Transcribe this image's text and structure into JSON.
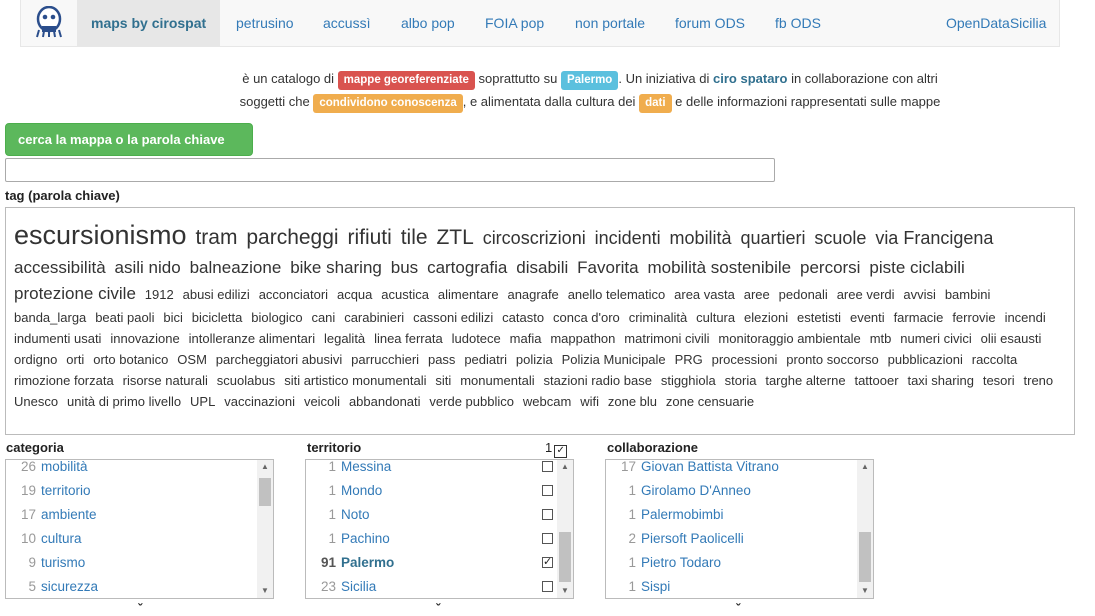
{
  "nav": {
    "brand": "maps by cirospat",
    "links": [
      "petrusino",
      "accussì",
      "albo pop",
      "FOIA pop",
      "non portale",
      "forum ODS",
      "fb ODS"
    ],
    "right": "OpenDataSicilia"
  },
  "intro": {
    "p1": "è un catalogo di",
    "b1": "mappe georeferenziate",
    "p2": "soprattutto su",
    "b2": "Palermo",
    "p3": ". Un iniziativa di",
    "author": "ciro spataro",
    "p4": "in collaborazione con altri",
    "p5": "soggetti che",
    "b3": "condividono conoscenza",
    "p6": ", e alimentata dalla cultura dei",
    "b4": "dati",
    "p7": "e delle informazioni rappresentati sulle mappe"
  },
  "search": {
    "button": "cerca la mappa o la parola chiave",
    "value": ""
  },
  "tags_label": "tag (parola chiave)",
  "tags": [
    {
      "t": "escursionismo",
      "s": 1
    },
    {
      "t": "tram",
      "s": 2
    },
    {
      "t": "parcheggi",
      "s": 2
    },
    {
      "t": "rifiuti",
      "s": 2
    },
    {
      "t": "tile",
      "s": 2
    },
    {
      "t": "ZTL",
      "s": 2
    },
    {
      "t": "circoscrizioni",
      "s": 3
    },
    {
      "t": "incidenti",
      "s": 3
    },
    {
      "t": "mobilità",
      "s": 3
    },
    {
      "t": "quartieri",
      "s": 3
    },
    {
      "t": "scuole",
      "s": 3
    },
    {
      "t": "via Francigena",
      "s": 3
    },
    {
      "t": "accessibilità",
      "s": 4
    },
    {
      "t": "asili nido",
      "s": 4
    },
    {
      "t": "balneazione",
      "s": 4
    },
    {
      "t": "bike sharing",
      "s": 4
    },
    {
      "t": "bus",
      "s": 4
    },
    {
      "t": "cartografia",
      "s": 4
    },
    {
      "t": "disabili",
      "s": 4
    },
    {
      "t": "Favorita",
      "s": 4
    },
    {
      "t": "mobilità sostenibile",
      "s": 4
    },
    {
      "t": "percorsi",
      "s": 4
    },
    {
      "t": "piste ciclabili",
      "s": 4
    },
    {
      "t": "protezione civile",
      "s": 4
    },
    {
      "t": "1912",
      "s": 5
    },
    {
      "t": "abusi edilizi",
      "s": 5
    },
    {
      "t": "acconciatori",
      "s": 5
    },
    {
      "t": "acqua",
      "s": 5
    },
    {
      "t": "acustica",
      "s": 5
    },
    {
      "t": "alimentare",
      "s": 5
    },
    {
      "t": "anagrafe",
      "s": 5
    },
    {
      "t": "anello telematico",
      "s": 5
    },
    {
      "t": "area vasta",
      "s": 5
    },
    {
      "t": "aree",
      "s": 5
    },
    {
      "t": "pedonali",
      "s": 5
    },
    {
      "t": "aree verdi",
      "s": 5
    },
    {
      "t": "avvisi",
      "s": 5
    },
    {
      "t": "bambini",
      "s": 5
    },
    {
      "t": "banda_larga",
      "s": 5
    },
    {
      "t": "beati paoli",
      "s": 5
    },
    {
      "t": "bici",
      "s": 5
    },
    {
      "t": "bicicletta",
      "s": 5
    },
    {
      "t": "biologico",
      "s": 5
    },
    {
      "t": "cani",
      "s": 5
    },
    {
      "t": "carabinieri",
      "s": 5
    },
    {
      "t": "cassoni edilizi",
      "s": 5
    },
    {
      "t": "catasto",
      "s": 5
    },
    {
      "t": "conca d'oro",
      "s": 5
    },
    {
      "t": "criminalità",
      "s": 5
    },
    {
      "t": "cultura",
      "s": 5
    },
    {
      "t": "elezioni",
      "s": 5
    },
    {
      "t": "estetisti",
      "s": 5
    },
    {
      "t": "eventi",
      "s": 5
    },
    {
      "t": "farmacie",
      "s": 5
    },
    {
      "t": "ferrovie",
      "s": 5
    },
    {
      "t": "incendi",
      "s": 5
    },
    {
      "t": "indumenti usati",
      "s": 5
    },
    {
      "t": "innovazione",
      "s": 5
    },
    {
      "t": "intolleranze alimentari",
      "s": 5
    },
    {
      "t": "legalità",
      "s": 5
    },
    {
      "t": "linea ferrata",
      "s": 5
    },
    {
      "t": "ludotece",
      "s": 5
    },
    {
      "t": "mafia",
      "s": 5
    },
    {
      "t": "mappathon",
      "s": 5
    },
    {
      "t": "matrimoni civili",
      "s": 5
    },
    {
      "t": "monitoraggio ambientale",
      "s": 5
    },
    {
      "t": "mtb",
      "s": 5
    },
    {
      "t": "numeri civici",
      "s": 5
    },
    {
      "t": "olii esausti",
      "s": 5
    },
    {
      "t": "ordigno",
      "s": 5
    },
    {
      "t": "orti",
      "s": 5
    },
    {
      "t": "orto botanico",
      "s": 5
    },
    {
      "t": "OSM",
      "s": 5
    },
    {
      "t": "parcheggiatori abusivi",
      "s": 5
    },
    {
      "t": "parrucchieri",
      "s": 5
    },
    {
      "t": "pass",
      "s": 5
    },
    {
      "t": "pediatri",
      "s": 5
    },
    {
      "t": "polizia",
      "s": 5
    },
    {
      "t": "Polizia Municipale",
      "s": 5
    },
    {
      "t": "PRG",
      "s": 5
    },
    {
      "t": "processioni",
      "s": 5
    },
    {
      "t": "pronto soccorso",
      "s": 5
    },
    {
      "t": "pubblicazioni",
      "s": 5
    },
    {
      "t": "raccolta",
      "s": 5
    },
    {
      "t": "rimozione forzata",
      "s": 5
    },
    {
      "t": "risorse naturali",
      "s": 5
    },
    {
      "t": "scuolabus",
      "s": 5
    },
    {
      "t": "siti artistico monumentali",
      "s": 5
    },
    {
      "t": "siti",
      "s": 5
    },
    {
      "t": "monumentali",
      "s": 5
    },
    {
      "t": "stazioni radio base",
      "s": 5
    },
    {
      "t": "stigghiola",
      "s": 5
    },
    {
      "t": "storia",
      "s": 5
    },
    {
      "t": "targhe alterne",
      "s": 5
    },
    {
      "t": "tattooer",
      "s": 5
    },
    {
      "t": "taxi sharing",
      "s": 5
    },
    {
      "t": "tesori",
      "s": 5
    },
    {
      "t": "treno",
      "s": 5
    },
    {
      "t": "Unesco",
      "s": 5
    },
    {
      "t": "unità di primo livello",
      "s": 5
    },
    {
      "t": "UPL",
      "s": 5
    },
    {
      "t": "vaccinazioni",
      "s": 5
    },
    {
      "t": "veicoli",
      "s": 5
    },
    {
      "t": "abbandonati",
      "s": 5
    },
    {
      "t": "verde pubblico",
      "s": 5
    },
    {
      "t": "webcam",
      "s": 5
    },
    {
      "t": "wifi",
      "s": 5
    },
    {
      "t": "zone blu",
      "s": 5
    },
    {
      "t": "zone censuarie",
      "s": 5
    }
  ],
  "categoria": {
    "label": "categoria",
    "items": [
      {
        "count": "26",
        "name": "mobilità"
      },
      {
        "count": "19",
        "name": "territorio"
      },
      {
        "count": "17",
        "name": "ambiente"
      },
      {
        "count": "10",
        "name": "cultura"
      },
      {
        "count": "9",
        "name": "turismo"
      },
      {
        "count": "5",
        "name": "sicurezza"
      }
    ]
  },
  "territorio": {
    "label": "territorio",
    "selected_count": "1",
    "items": [
      {
        "count": "1",
        "name": "Messina",
        "checked": false
      },
      {
        "count": "1",
        "name": "Mondo",
        "checked": false
      },
      {
        "count": "1",
        "name": "Noto",
        "checked": false
      },
      {
        "count": "1",
        "name": "Pachino",
        "checked": false
      },
      {
        "count": "91",
        "name": "Palermo",
        "checked": true
      },
      {
        "count": "23",
        "name": "Sicilia",
        "checked": false
      }
    ]
  },
  "collaborazione": {
    "label": "collaborazione",
    "items": [
      {
        "count": "17",
        "name": "Giovan Battista Vitrano"
      },
      {
        "count": "1",
        "name": "Girolamo D'Anneo"
      },
      {
        "count": "1",
        "name": "Palermobimbi"
      },
      {
        "count": "2",
        "name": "Piersoft Paolicelli"
      },
      {
        "count": "1",
        "name": "Pietro Todaro"
      },
      {
        "count": "1",
        "name": "Sispi"
      }
    ]
  },
  "colors": {
    "green": "#5cb85c",
    "red": "#d9534f",
    "blue": "#5bc0de",
    "orange": "#f0ad4e",
    "link": "#337ab7"
  }
}
